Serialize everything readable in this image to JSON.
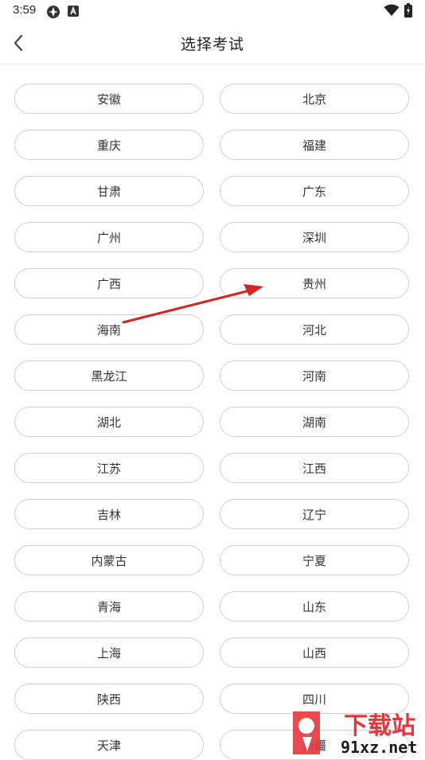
{
  "status_bar": {
    "time": "3:59"
  },
  "header": {
    "title": "选择考试"
  },
  "exams": [
    "安徽",
    "北京",
    "重庆",
    "福建",
    "甘肃",
    "广东",
    "广州",
    "深圳",
    "广西",
    "贵州",
    "海南",
    "河北",
    "黑龙江",
    "河南",
    "湖北",
    "湖南",
    "江苏",
    "江西",
    "吉林",
    "辽宁",
    "内蒙古",
    "宁夏",
    "青海",
    "山东",
    "上海",
    "山西",
    "陕西",
    "四川",
    "天津",
    "新疆"
  ],
  "watermark": {
    "text_top": "下载站",
    "text_bottom": "91xz.net",
    "accent": "#e8353b"
  },
  "colors": {
    "pill_border": "#cfcfcf",
    "annotation_arrow": "#d62424"
  }
}
